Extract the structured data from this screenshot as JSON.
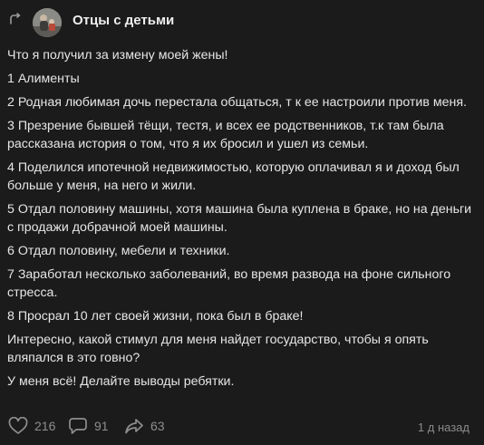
{
  "header": {
    "repost_icon": "repost-icon",
    "group_name": "Отцы с детьми"
  },
  "post": {
    "paragraphs": [
      "Что я получил за измену моей жены!",
      "1 Алименты",
      "2 Родная любимая дочь перестала общаться, т к ее настроили против меня.",
      "3 Презрение бывшей тёщи, тестя, и всех ее родственников, т.к там была рассказана история о том, что я их бросил и ушел из семьи.",
      "4 Поделился ипотечной недвижимостью, которую оплачивал я и доход был больше у меня, на него и жили.",
      "5 Отдал половину машины, хотя машина была куплена в браке, но на деньги с продажи добрачной моей машины.",
      "6 Отдал половину, мебели и техники.",
      "7 Заработал несколько заболеваний, во время развода на фоне сильного стресса.",
      "8 Просрал 10 лет своей жизни, пока был в браке!",
      "Интересно, какой стимул для меня найдет государство, чтобы я опять вляпался в это говно?",
      "У меня всё! Делайте выводы ребятки."
    ]
  },
  "footer": {
    "likes": "216",
    "comments": "91",
    "shares": "63",
    "time": "1 д назад",
    "icons": [
      "heart-icon",
      "comment-icon",
      "share-icon"
    ]
  }
}
